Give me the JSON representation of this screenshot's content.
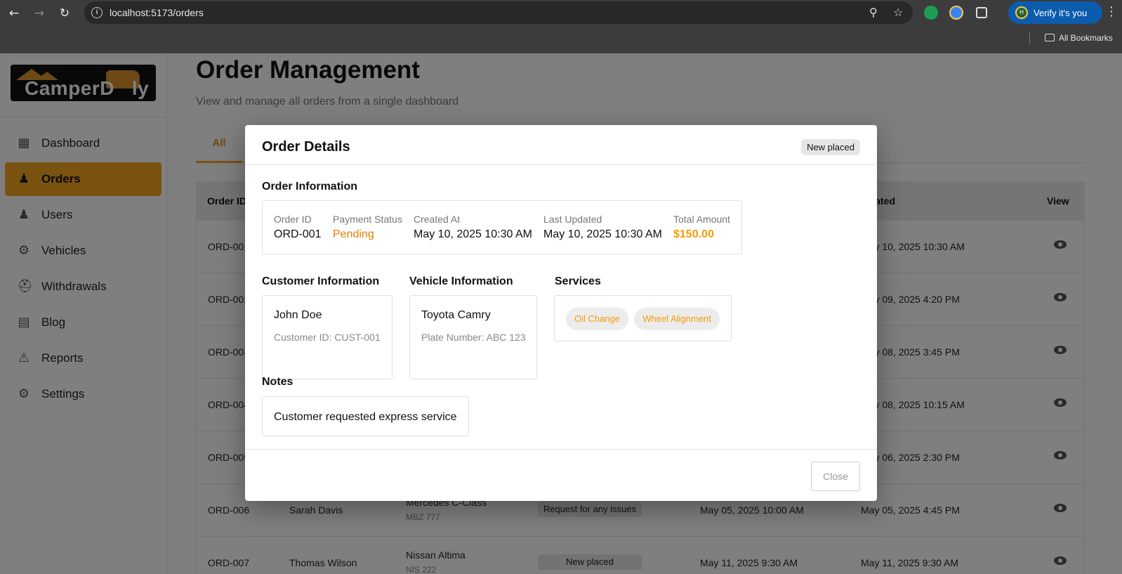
{
  "browser": {
    "url": "localhost:5173/orders",
    "verify_label": "Verify it's you",
    "avatar_initial": "H",
    "bookmarks_label": "All Bookmarks"
  },
  "sidebar": {
    "logo_text": "CamperDooly",
    "items": [
      {
        "label": "Dashboard",
        "icon": "dashboard-icon",
        "active": false
      },
      {
        "label": "Orders",
        "icon": "people-icon",
        "active": true
      },
      {
        "label": "Users",
        "icon": "people-icon",
        "active": false
      },
      {
        "label": "Vehicles",
        "icon": "gear-icon",
        "active": false
      },
      {
        "label": "Withdrawals",
        "icon": "bank-icon",
        "active": false
      },
      {
        "label": "Blog",
        "icon": "article-icon",
        "active": false
      },
      {
        "label": "Reports",
        "icon": "alert-icon",
        "active": false
      },
      {
        "label": "Settings",
        "icon": "gear-icon",
        "active": false
      }
    ]
  },
  "page": {
    "title": "Order Management",
    "subtitle": "View and manage all orders from a single dashboard",
    "tab_all": "All"
  },
  "table": {
    "headers": {
      "order_id": "Order ID",
      "updated": "Updated",
      "view": "View"
    },
    "rows": [
      {
        "id": "ORD-001",
        "customer": "",
        "vehicle": "",
        "plate": "",
        "status": "",
        "created": "",
        "updated": "May 10, 2025 10:30 AM"
      },
      {
        "id": "ORD-002",
        "customer": "",
        "vehicle": "",
        "plate": "",
        "status": "",
        "created": "",
        "updated": "May 09, 2025 4:20 PM"
      },
      {
        "id": "ORD-003",
        "customer": "",
        "vehicle": "",
        "plate": "",
        "status": "",
        "created": "",
        "updated": "May 08, 2025 3:45 PM"
      },
      {
        "id": "ORD-004",
        "customer": "",
        "vehicle": "",
        "plate": "",
        "status": "",
        "created": "",
        "updated": "May 08, 2025 10:15 AM"
      },
      {
        "id": "ORD-005",
        "customer": "",
        "vehicle": "",
        "plate": "",
        "status": "",
        "created": "",
        "updated": "May 06, 2025 2:30 PM"
      },
      {
        "id": "ORD-006",
        "customer": "Sarah Davis",
        "vehicle": "Mercedes C-Class",
        "plate": "MBZ 777",
        "status": "Request for any issues",
        "created": "May 05, 2025 10:00 AM",
        "updated": "May 05, 2025 4:45 PM"
      },
      {
        "id": "ORD-007",
        "customer": "Thomas Wilson",
        "vehicle": "Nissan Altima",
        "plate": "NIS 222",
        "status": "New placed",
        "created": "May 11, 2025 9:30 AM",
        "updated": "May 11, 2025 9:30 AM"
      }
    ]
  },
  "modal": {
    "title": "Order Details",
    "status_badge": "New placed",
    "order_info": {
      "section_title": "Order Information",
      "order_id_label": "Order ID",
      "order_id": "ORD-001",
      "payment_status_label": "Payment Status",
      "payment_status": "Pending",
      "created_at_label": "Created At",
      "created_at": "May 10, 2025 10:30 AM",
      "last_updated_label": "Last Updated",
      "last_updated": "May 10, 2025 10:30 AM",
      "total_amount_label": "Total Amount",
      "total_amount": "$150.00"
    },
    "customer": {
      "section_title": "Customer Information",
      "name": "John Doe",
      "customer_id": "Customer ID: CUST-001"
    },
    "vehicle": {
      "section_title": "Vehicle Information",
      "name": "Toyota Camry",
      "plate": "Plate Number: ABC 123"
    },
    "services": {
      "section_title": "Services",
      "items": [
        "Oil Change",
        "Wheel Alignment"
      ]
    },
    "notes": {
      "section_title": "Notes",
      "text": "Customer requested express service"
    },
    "close_label": "Close"
  },
  "colors": {
    "accent": "#f5a623",
    "pending": "#e67e00",
    "amount": "#f59b0a",
    "chrome": "#3c3c3c"
  }
}
